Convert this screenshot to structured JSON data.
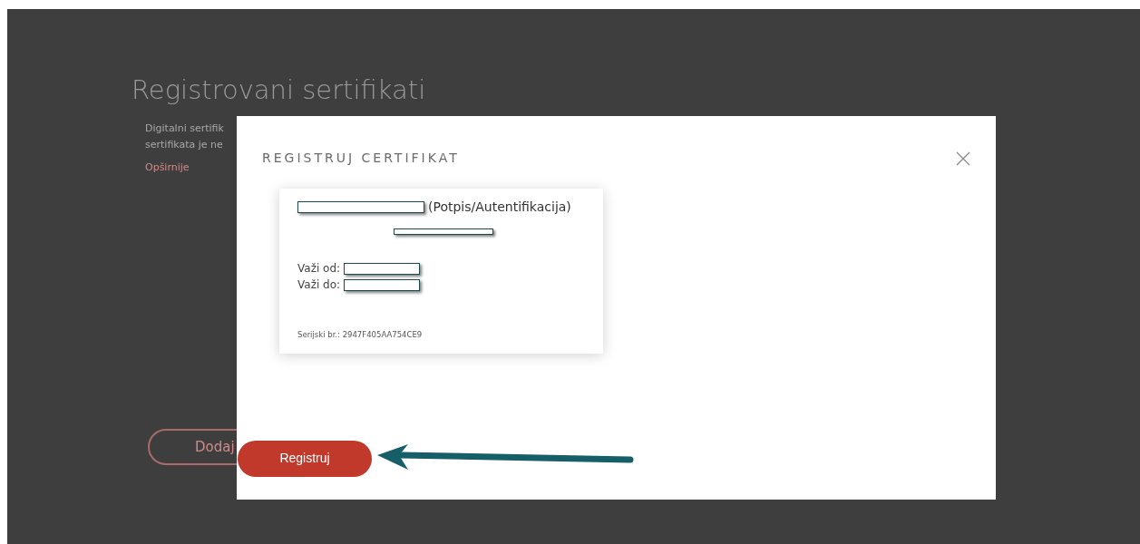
{
  "page": {
    "title": "Registrovani sertifikati",
    "description_lines": [
      "Digitalni sertifik",
      "sertifikata je ne"
    ],
    "more_link": "Opširnije",
    "add_button": "Dodaj"
  },
  "modal": {
    "title": "REGISTRUJ CERTIFIKAT",
    "certificate": {
      "type_label": "(Potpis/Autentifikacija)",
      "valid_from_label": "Važi od:",
      "valid_to_label": "Važi do:",
      "serial": "Serijski br.: 2947F405AA754CE9"
    },
    "submit_button": "Registruj"
  }
}
